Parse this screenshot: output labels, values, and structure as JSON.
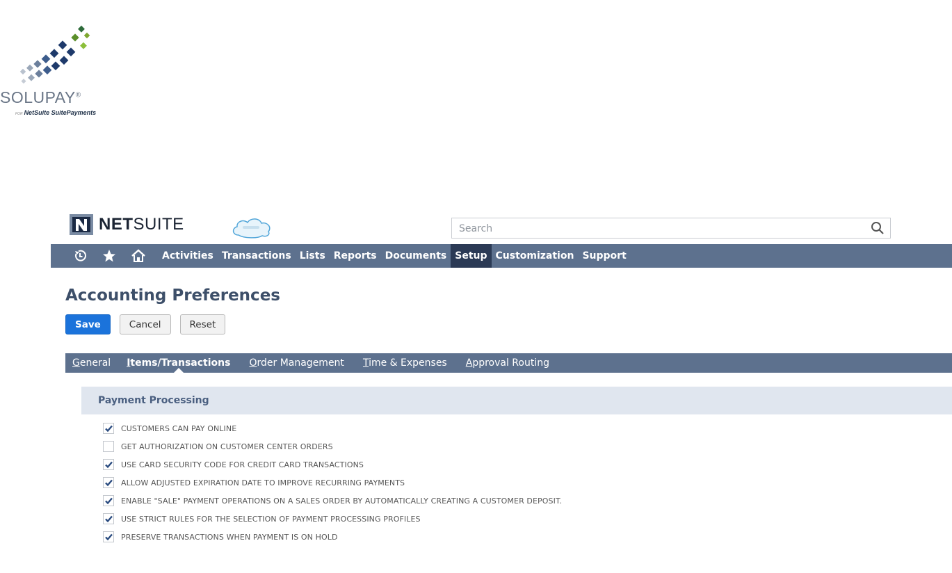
{
  "logo": {
    "wordmark": "SOLUPAY",
    "registered": "®",
    "tagline_prefix": "FOR",
    "tagline": "NetSuite SuitePayments"
  },
  "header": {
    "brand_bold": "NET",
    "brand_rest": "SUITE",
    "search_placeholder": "Search"
  },
  "nav": {
    "icons": [
      "recent-icon",
      "star-icon",
      "home-icon"
    ],
    "items": [
      "Activities",
      "Transactions",
      "Lists",
      "Reports",
      "Documents",
      "Setup",
      "Customization",
      "Support"
    ],
    "active": "Setup"
  },
  "page": {
    "title": "Accounting Preferences",
    "buttons": {
      "save": "Save",
      "cancel": "Cancel",
      "reset": "Reset"
    }
  },
  "subtabs": [
    {
      "first": "G",
      "rest": "eneral"
    },
    {
      "first": "I",
      "rest": "tems/Transactions",
      "active": true
    },
    {
      "first": "O",
      "rest": "rder Management"
    },
    {
      "first": "T",
      "rest": "ime & Expenses"
    },
    {
      "first": "A",
      "rest": "pproval Routing"
    }
  ],
  "section": {
    "title": "Payment Processing",
    "options": [
      {
        "label": "CUSTOMERS CAN PAY ONLINE",
        "checked": true
      },
      {
        "label": "GET AUTHORIZATION ON CUSTOMER CENTER ORDERS",
        "checked": false
      },
      {
        "label": "USE CARD SECURITY CODE FOR CREDIT CARD TRANSACTIONS",
        "checked": true
      },
      {
        "label": "ALLOW ADJUSTED EXPIRATION DATE TO IMPROVE RECURRING PAYMENTS",
        "checked": true
      },
      {
        "label": "ENABLE \"SALE\" PAYMENT OPERATIONS ON A SALES ORDER BY AUTOMATICALLY CREATING A CUSTOMER DEPOSIT.",
        "checked": true
      },
      {
        "label": "USE STRICT RULES FOR THE SELECTION OF PAYMENT PROCESSING PROFILES",
        "checked": true
      },
      {
        "label": "PRESERVE TRANSACTIONS WHEN PAYMENT IS ON HOLD",
        "checked": true
      }
    ]
  },
  "colors": {
    "nav_bar": "#5d718e",
    "nav_active": "#2b3a55",
    "primary_button": "#1b73db",
    "title": "#3d4f69",
    "section_bg": "#e0e6ef",
    "check": "#2b4c80"
  }
}
